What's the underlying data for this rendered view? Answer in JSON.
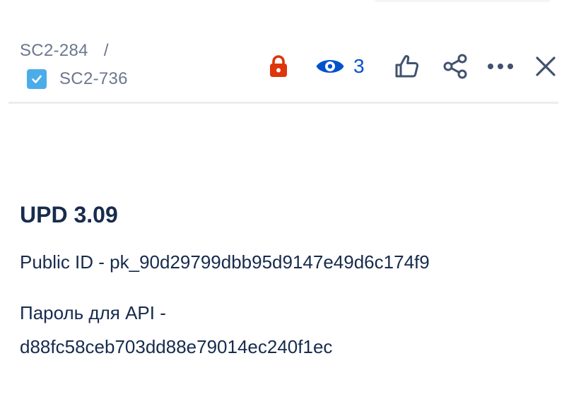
{
  "breadcrumb": {
    "parent_key": "SC2-284",
    "separator": "/",
    "current_key": "SC2-736",
    "current_type_icon": "checkbox-task-icon"
  },
  "toolbar": {
    "restriction_icon": "lock-icon",
    "watch_icon": "eye-icon",
    "watch_count": "3",
    "vote_icon": "thumbs-up-icon",
    "share_icon": "share-icon",
    "more_icon": "more-icon",
    "close_icon": "close-icon"
  },
  "issue": {
    "summary": "UPD 3.09",
    "description_lines": [
      "Public ID - pk_90d29799dbb95d9147e49d6c174f9",
      "Пароль для API -",
      "d88fc58ceb703dd88e79014ec240f1ec"
    ]
  },
  "colors": {
    "text_primary": "#172b4d",
    "text_subtle": "#6b778c",
    "brand_blue": "#0052cc",
    "lock_red": "#de350b",
    "task_blue": "#4bade8",
    "icon_dark": "#42526e"
  }
}
